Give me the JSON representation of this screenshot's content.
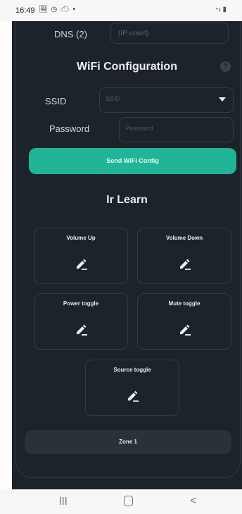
{
  "status_bar": {
    "time": "16:49",
    "notification_icons": "🖼 ◷ ☁ •",
    "system_icons": "◔ᵢₗ ▮"
  },
  "dns": {
    "label": "DNS (2)",
    "value": "(IP unset)"
  },
  "wifi": {
    "title": "WiFi Configuration",
    "help_icon": "?",
    "ssid_label": "SSID",
    "ssid_placeholder": "SSID",
    "password_label": "Password",
    "password_placeholder": "Password",
    "send_button": "Send WiFi Config"
  },
  "ir": {
    "title": "Ir Learn",
    "buttons": [
      {
        "label": "Volume Up"
      },
      {
        "label": "Volume Down"
      },
      {
        "label": "Power toggle"
      },
      {
        "label": "Mute toggle"
      },
      {
        "label": "Source toggle"
      }
    ]
  },
  "zone_button": "Zone 1",
  "colors": {
    "background": "#1d232a",
    "accent": "#1fb596",
    "border": "#343b45"
  }
}
